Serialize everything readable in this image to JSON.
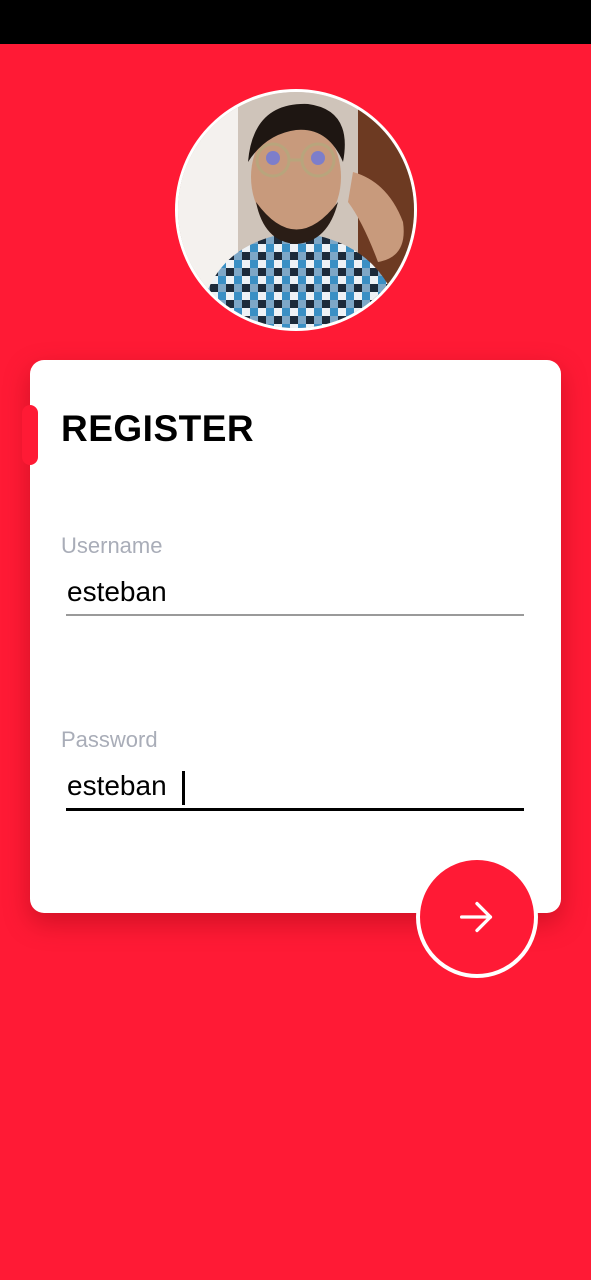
{
  "colors": {
    "primary": "#ff1a35",
    "card": "#ffffff",
    "label": "#a9adb8",
    "status_bar": "#000000"
  },
  "profile": {
    "avatar": "profile-photo"
  },
  "form": {
    "title": "REGISTER",
    "username": {
      "label": "Username",
      "value": "esteban"
    },
    "password": {
      "label": "Password",
      "value": "esteban"
    },
    "submit_icon": "arrow-right-icon"
  }
}
